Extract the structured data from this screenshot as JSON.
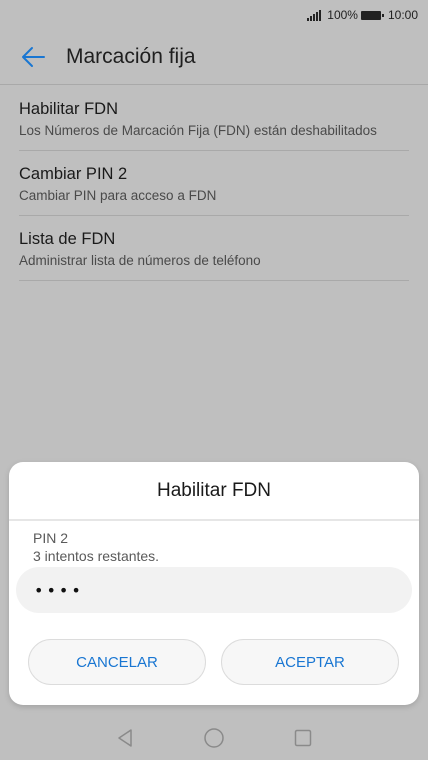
{
  "status_bar": {
    "battery": "100%",
    "time": "10:00"
  },
  "header": {
    "title": "Marcación fija"
  },
  "settings": [
    {
      "title": "Habilitar FDN",
      "subtitle": "Los Números de Marcación Fija (FDN) están deshabilitados"
    },
    {
      "title": "Cambiar PIN 2",
      "subtitle": "Cambiar PIN para acceso a FDN"
    },
    {
      "title": "Lista de FDN",
      "subtitle": "Administrar lista de números de teléfono"
    }
  ],
  "dialog": {
    "title": "Habilitar FDN",
    "pin_label": "PIN 2",
    "attempts": "3 intentos restantes.",
    "pin_value": "••••",
    "cancel_label": "CANCELAR",
    "accept_label": "ACEPTAR"
  },
  "colors": {
    "accent": "#1976d2",
    "overlay": "#bfbfbf"
  },
  "icons": {
    "back": "arrow-left-icon",
    "nav_back": "triangle-back-icon",
    "nav_home": "circle-home-icon",
    "nav_recent": "square-recent-icon"
  }
}
